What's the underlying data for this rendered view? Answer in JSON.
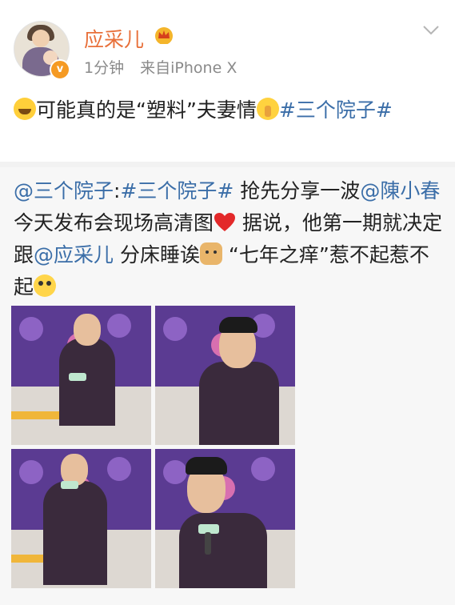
{
  "post": {
    "username": "应采儿",
    "time": "1分钟",
    "source": "来自iPhone X",
    "text": {
      "part1": "可能真的是“塑料”夫妻情",
      "hashtag": "#三个院子#"
    }
  },
  "repost": {
    "mention_account": "@三个院子",
    "colon": ":",
    "hashtag": "#三个院子#",
    "seg1": " 抢先分享一波",
    "mention_chen": "@陳小春",
    "seg2": " 今天发布会现场高清图",
    "seg3": " 据说，他第一期就决定跟",
    "mention_ying": "@应采儿",
    "seg4": " 分床睡诶",
    "seg5": " “七年之痒”惹不起惹不起",
    "photo_count": 4
  },
  "colors": {
    "username": "#e8703a",
    "link": "#3b6ea8",
    "meta": "#8a8a8a",
    "repost_bg": "#f7f7f7"
  },
  "icons": [
    "verified-badge-icon",
    "crown-icon",
    "chevron-down-icon",
    "grin-emoji-icon",
    "shush-emoji-icon",
    "heart-emoji-icon",
    "doge-emoji-icon",
    "eyeroll-emoji-icon"
  ]
}
